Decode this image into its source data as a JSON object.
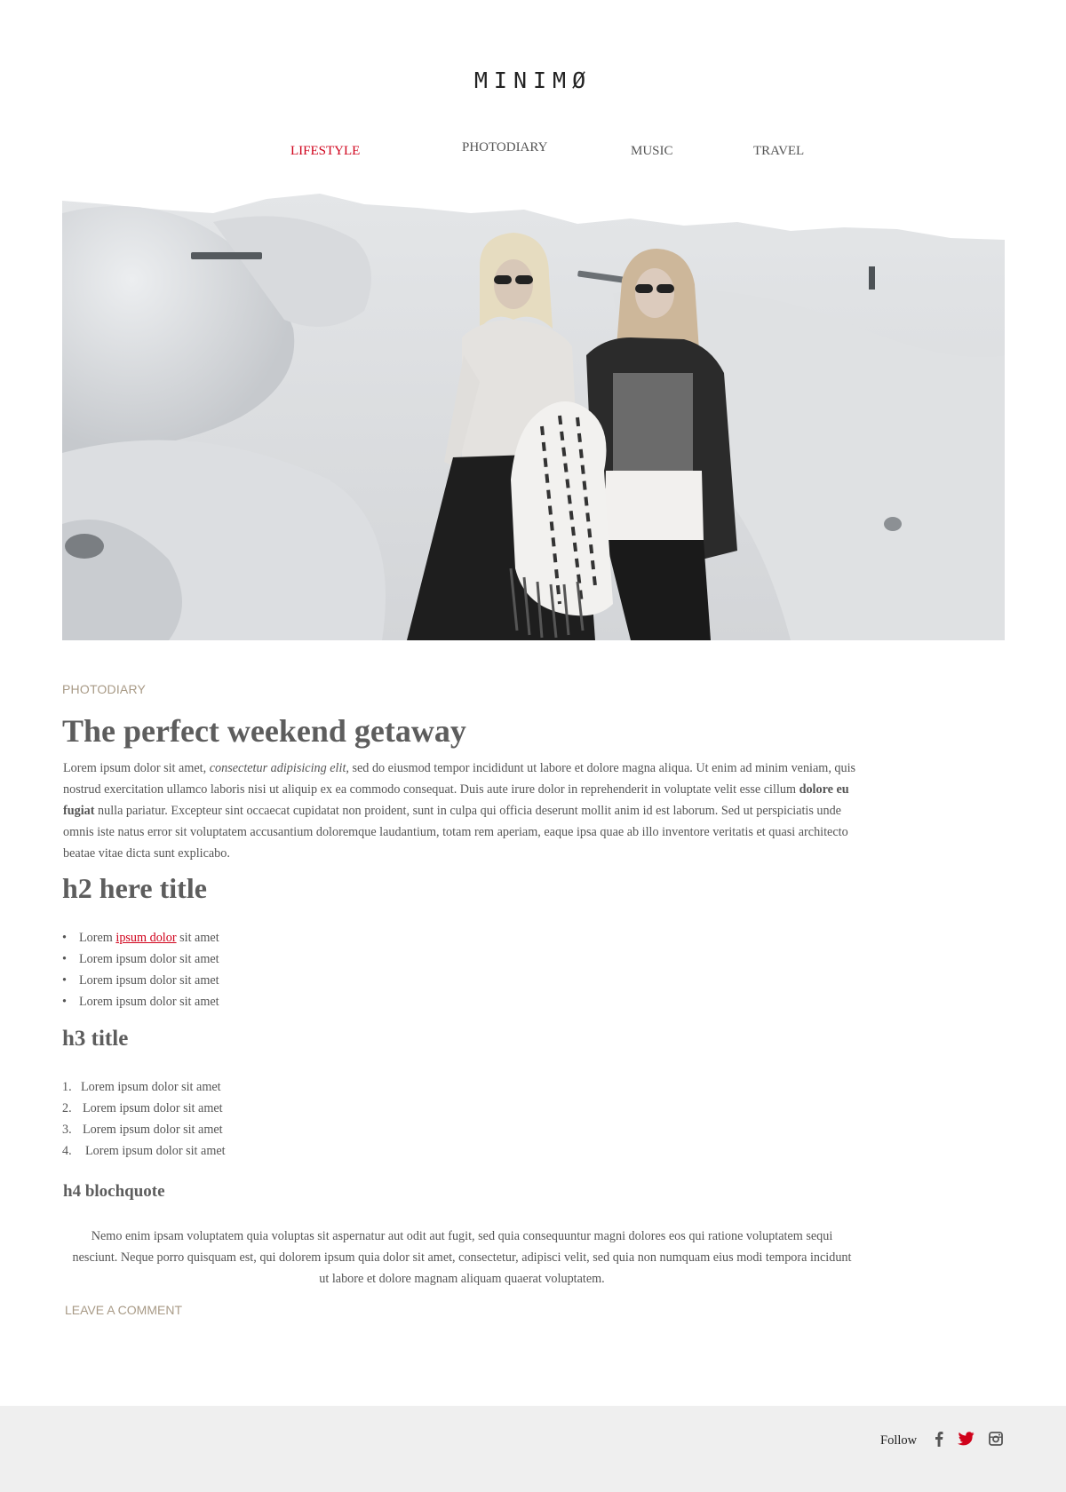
{
  "brand": {
    "logo": "MINIMØ"
  },
  "nav": {
    "items": [
      {
        "label": "LIFESTYLE",
        "active": true
      },
      {
        "label": "PHOTODIARY",
        "active": false
      },
      {
        "label": "MUSIC",
        "active": false
      },
      {
        "label": "TRAVEL",
        "active": false
      }
    ]
  },
  "colors": {
    "accent": "#d0021b",
    "category": "#a89a86",
    "footer_bg": "#efefef",
    "text": "#555555"
  },
  "post": {
    "category": "PHOTODIARY",
    "title": "The perfect weekend getaway",
    "intro": {
      "p1": "Lorem ipsum dolor sit amet, ",
      "em": "consectetur adipisicing elit,",
      "p2": " sed do eiusmod tempor incididunt ut labore et dolore magna aliqua. Ut enim ad minim veniam, quis nostrud exercitation ullamco laboris nisi ut aliquip ex ea commodo consequat. Duis aute irure dolor in reprehenderit in voluptate velit esse cillum ",
      "strong": "dolore eu fugiat",
      "p3": " nulla pariatur. Excepteur sint occaecat cupidatat non proident, sunt in culpa qui officia deserunt mollit anim id est laborum. Sed ut perspiciatis unde omnis iste natus error sit voluptatem accusantium doloremque laudantium, totam rem aperiam, eaque ipsa quae ab illo inventore veritatis et quasi architecto beatae vitae dicta sunt explicabo."
    },
    "h2": "h2 here title",
    "ul": {
      "first": {
        "before": "Lorem ",
        "link": "ipsum dolor",
        "after": " sit amet"
      },
      "rest": [
        "Lorem ipsum dolor sit amet",
        "Lorem ipsum dolor sit amet",
        "Lorem ipsum dolor sit amet"
      ],
      "bullet": "•"
    },
    "h3": "h3 title",
    "ol": {
      "items": [
        "Lorem ipsum dolor sit amet",
        "Lorem ipsum dolor sit amet",
        "Lorem ipsum dolor sit amet",
        "Lorem ipsum dolor sit amet"
      ],
      "numbers": [
        "1.",
        "2.",
        "3.",
        "4."
      ]
    },
    "h4": "h4 blochquote",
    "blockquote": "Nemo enim ipsam voluptatem quia voluptas sit aspernatur aut odit aut fugit, sed quia consequuntur magni dolores eos qui ratione voluptatem sequi nesciunt. Neque porro quisquam est, qui dolorem ipsum quia dolor sit amet, consectetur, adipisci velit, sed quia non numquam eius modi tempora incidunt ut labore et dolore magnam aliquam quaerat voluptatem.",
    "leave_comment": "LEAVE A COMMENT"
  },
  "footer": {
    "follow_label": "Follow",
    "social": [
      {
        "icon": "facebook-icon",
        "color": "#555555"
      },
      {
        "icon": "twitter-icon",
        "color": "#d0021b"
      },
      {
        "icon": "instagram-icon",
        "color": "#555555"
      }
    ]
  }
}
